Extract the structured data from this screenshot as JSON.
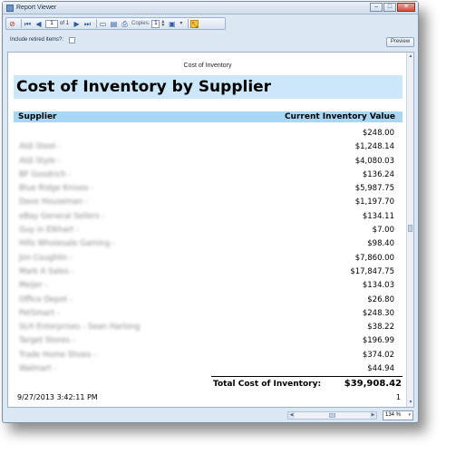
{
  "window": {
    "title": "Report Viewer"
  },
  "toolbar": {
    "page_current": "1",
    "page_of": "of 1",
    "copies_label": "Copies:",
    "copies_value": "1",
    "icons": [
      "stop-icon",
      "first-page-icon",
      "prev-page-icon",
      "next-page-icon",
      "last-page-icon",
      "page-setup-icon",
      "print-preview-icon",
      "print-icon",
      "save-icon",
      "dropdown-icon",
      "fit-page-icon"
    ]
  },
  "options": {
    "retired_label": "Include retired items?:",
    "retired_checked": false,
    "preview_label": "Preview"
  },
  "report": {
    "page_header": "Cost of Inventory",
    "title": "Cost of Inventory by Supplier",
    "col_supplier": "Supplier",
    "col_value": "Current Inventory Value",
    "rows": [
      {
        "supplier": "",
        "value": "$248.00"
      },
      {
        "supplier": "Aldi Steel -",
        "value": "$1,248.14"
      },
      {
        "supplier": "Aldi Style -",
        "value": "$4,080.03"
      },
      {
        "supplier": "BF Goodrich -",
        "value": "$136.24"
      },
      {
        "supplier": "Blue Ridge Knives -",
        "value": "$5,987.75"
      },
      {
        "supplier": "Dave Houseman -",
        "value": "$1,197.70"
      },
      {
        "supplier": "eBay General Sellers -",
        "value": "$134.11"
      },
      {
        "supplier": "Guy in Elkhart -",
        "value": "$7.00"
      },
      {
        "supplier": "Hills Wholesale Gaming -",
        "value": "$98.40"
      },
      {
        "supplier": "Jim Coughlin -",
        "value": "$7,860.00"
      },
      {
        "supplier": "Mark A Sales -",
        "value": "$17,847.75"
      },
      {
        "supplier": "Meijer -",
        "value": "$134.03"
      },
      {
        "supplier": "Office Depot -",
        "value": "$26.80"
      },
      {
        "supplier": "PetSmart -",
        "value": "$248.30"
      },
      {
        "supplier": "SLH Enterprises - Sean Harlong",
        "value": "$38.22"
      },
      {
        "supplier": "Target Stores -",
        "value": "$196.99"
      },
      {
        "supplier": "Trade Home Shoes -",
        "value": "$374.02"
      },
      {
        "supplier": "Walmart -",
        "value": "$44.94"
      }
    ],
    "total_label": "Total Cost of Inventory:",
    "total_value": "$39,908.42",
    "footer_date": "9/27/2013 3:42:11 PM",
    "footer_page": "1"
  },
  "status": {
    "zoom": "134 %"
  }
}
